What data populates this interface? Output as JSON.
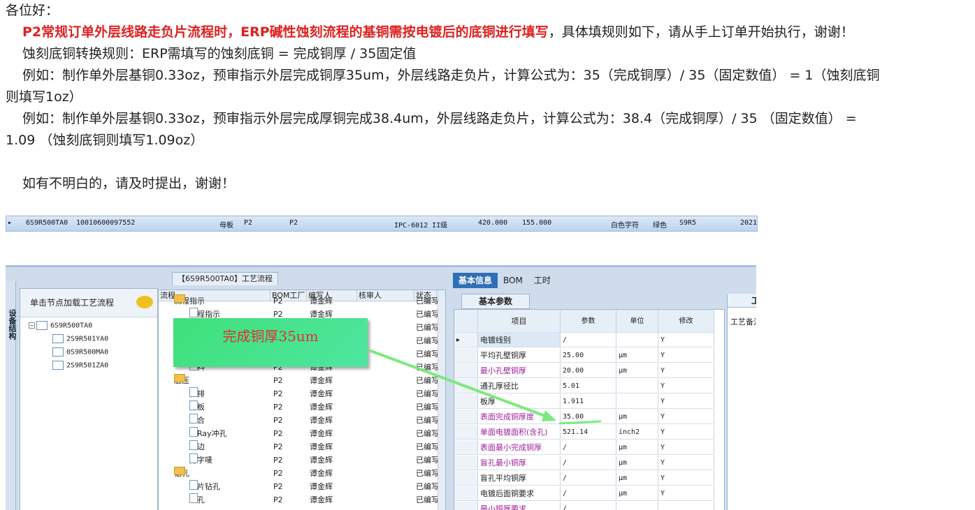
{
  "doc": {
    "greeting": "各位好：",
    "p1_bold": "P2常规订单外层线路走负片流程时，ERP碱性蚀刻流程的基铜需按电镀后的底铜进行填写",
    "p1_rest": "，具体填规则如下，请从手上订单开始执行，谢谢！",
    "p2": "蚀刻底铜转换规则：ERP需填写的蚀刻底铜 = 完成铜厚 / 35固定值",
    "p3a": "例如：制作单外层基铜0.33oz，预审指示外层完成铜厚35um，外层线路走负片，计算公式为：35（完成铜厚）/ 35（固定数值） = 1（蚀刻底铜",
    "p3b": "则填写1oz）",
    "p4a": "例如：制作单外层基铜0.33oz，预审指示外层完成厚铜完成38.4um，外层线路走负片，计算公式为：38.4（完成铜厚）/ 35 （固定数值） =",
    "p4b": "1.09 （蚀刻底铜则填写1.09oz）",
    "p5": "如有不明白的，请及时提出，谢谢！"
  },
  "infobar": {
    "arrow": "▸",
    "code": "6S9R500TA0",
    "number": "10010600097552",
    "board": "母板",
    "p2a": "P2",
    "p2b": "P2",
    "ipc": "IPC-6012 II级",
    "w": "420.000",
    "h": "155.000",
    "color": "白色字符",
    "mask": "绿色",
    "s9": "S9R5",
    "year": "2021"
  },
  "app": {
    "vtab": "设备结构",
    "left_header": "单击节点加载工艺流程",
    "tree": [
      "6S9R500TA0",
      "2S9R501YA0",
      "0S9R500MA0",
      "2S9R501ZA0"
    ],
    "mid_title": "【6S9R500TA0】工艺流程",
    "mid_headers": [
      "流程",
      "BOM工厂",
      "编写人",
      "核审人",
      "状态"
    ],
    "mid_rows": [
      {
        "name": "流程指示",
        "bom": "P2",
        "writer": "谭金辉",
        "status": "已编写",
        "kind": "folder-partial"
      },
      {
        "name": "流程指示",
        "bom": "P2",
        "writer": "谭金辉",
        "status": "已编写",
        "kind": "doc"
      },
      {
        "name": "",
        "bom": "",
        "writer": "",
        "status": "已编写",
        "kind": "hidden"
      },
      {
        "name": "",
        "bom": "",
        "writer": "",
        "status": "已编写",
        "kind": "hidden"
      },
      {
        "name": "",
        "bom": "",
        "writer": "",
        "status": "已编写",
        "kind": "hidden"
      },
      {
        "name": "开料",
        "bom": "P2",
        "writer": "谭金辉",
        "status": "已编写",
        "kind": "doc"
      },
      {
        "name": "层压",
        "bom": "P2",
        "writer": "谭金辉",
        "status": "已编写",
        "kind": "folder"
      },
      {
        "name": "预排",
        "bom": "P2",
        "writer": "谭金辉",
        "status": "已编写",
        "kind": "doc"
      },
      {
        "name": "排板",
        "bom": "P2",
        "writer": "谭金辉",
        "status": "已编写",
        "kind": "doc"
      },
      {
        "name": "压合",
        "bom": "P2",
        "writer": "谭金辉",
        "status": "已编写",
        "kind": "doc"
      },
      {
        "name": "X-Ray冲孔",
        "bom": "P2",
        "writer": "谭金辉",
        "status": "已编写",
        "kind": "doc"
      },
      {
        "name": "铣边",
        "bom": "P2",
        "writer": "谭金辉",
        "status": "已编写",
        "kind": "doc"
      },
      {
        "name": "打字唛",
        "bom": "P2",
        "writer": "谭金辉",
        "status": "已编写",
        "kind": "doc"
      },
      {
        "name": "钻孔",
        "bom": "P2",
        "writer": "谭金辉",
        "status": "已编写",
        "kind": "folder"
      },
      {
        "name": "铝片钻孔",
        "bom": "P2",
        "writer": "谭金辉",
        "status": "已编写",
        "kind": "doc"
      },
      {
        "name": "钻孔",
        "bom": "P2",
        "writer": "谭金辉",
        "status": "已编写",
        "kind": "doc"
      }
    ],
    "right_tabs": [
      "基本信息",
      "BOM",
      "工时"
    ],
    "subtab": "基本参数",
    "grid_headers": [
      "项目",
      "参数",
      "单位",
      "修改"
    ],
    "grid_rows": [
      {
        "item": "电镀线别",
        "value": "/",
        "unit": "",
        "mod": "Y",
        "purple": false,
        "current": true
      },
      {
        "item": "平均孔壁铜厚",
        "value": "25.00",
        "unit": "μm",
        "mod": "Y",
        "purple": false
      },
      {
        "item": "最小孔壁铜厚",
        "value": "20.00",
        "unit": "μm",
        "mod": "Y",
        "purple": true
      },
      {
        "item": "通孔厚径比",
        "value": "5.01",
        "unit": "",
        "mod": "Y",
        "purple": false
      },
      {
        "item": "板厚",
        "value": "1.911",
        "unit": "",
        "mod": "Y",
        "purple": false
      },
      {
        "item": "表面完成铜厚度",
        "value": "35.00",
        "unit": "μm",
        "mod": "Y",
        "purple": true
      },
      {
        "item": "单面电镀面积(含孔)",
        "value": "521.14",
        "unit": "inch2",
        "mod": "Y",
        "purple": true
      },
      {
        "item": "表面最小完成铜厚",
        "value": "/",
        "unit": "μm",
        "mod": "Y",
        "purple": true
      },
      {
        "item": "盲孔最小铜厚",
        "value": "/",
        "unit": "μm",
        "mod": "Y",
        "purple": true
      },
      {
        "item": "盲孔平均铜厚",
        "value": "/",
        "unit": "μm",
        "mod": "Y",
        "purple": false
      },
      {
        "item": "电镀后面铜要求",
        "value": "/",
        "unit": "μm",
        "mod": "Y",
        "purple": false
      },
      {
        "item": "最小铜厚要求",
        "value": "/",
        "unit": "",
        "mod": "",
        "purple": true
      }
    ],
    "far_right_tab": "工",
    "far_right_label": "工艺备注"
  },
  "callout": "完成铜厚35um",
  "colors": {
    "red": "#e02020",
    "callout_bg": "#3fe07a",
    "callout_text": "#e03030",
    "arrow": "#66ee66",
    "tab_active": "#2f6fb6"
  }
}
